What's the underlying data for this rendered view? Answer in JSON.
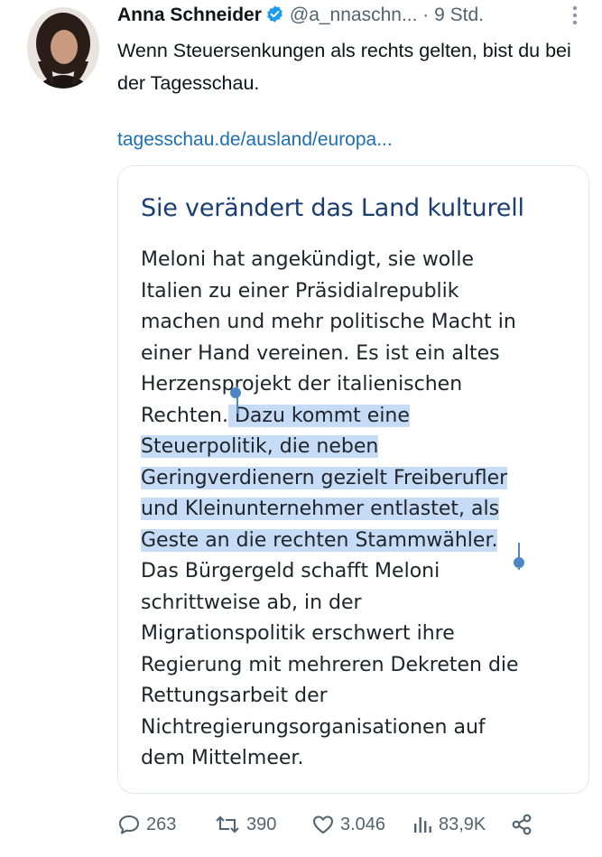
{
  "tweet": {
    "author_name": "Anna Schneider",
    "handle": "@a_nnaschn...",
    "separator": "·",
    "time": "9 Std.",
    "text": "Wenn Steuersenkungen als rechts gelten, bist du bei der Tagesschau.",
    "link": "tagesschau.de/ausland/europa..."
  },
  "card": {
    "headline": "Sie verändert das Land kulturell",
    "lines": [
      "Meloni hat angekündigt, sie wolle",
      "Italien zu einer Präsidialrepublik",
      "machen und mehr politische Macht in",
      "einer Hand vereinen. Es ist ein altes",
      "Herzensprojekt der italienischen",
      "Rechten.",
      " Dazu kommt eine",
      "Steuerpolitik, die neben",
      "Geringverdienern gezielt Freiberufler",
      "und Kleinunternehmer entlastet, als",
      "Geste an die rechten Stammwähler.",
      "Das Bürgergeld schafft Meloni",
      "schrittweise ab, in der",
      "Migrationspolitik erschwert ihre",
      "Regierung mit mehreren Dekreten die",
      "Rettungsarbeit der",
      "Nichtregierungsorganisationen auf",
      "dem Mittelmeer."
    ]
  },
  "stats": {
    "replies": "263",
    "retweets": "390",
    "likes": "3.046",
    "views": "83,9K"
  },
  "colors": {
    "link": "#1d6fb4",
    "headline": "#1a3e74",
    "selection": "#c6dcf6",
    "selection_handle": "#4f86c6",
    "verified": "#1d9bf0"
  }
}
